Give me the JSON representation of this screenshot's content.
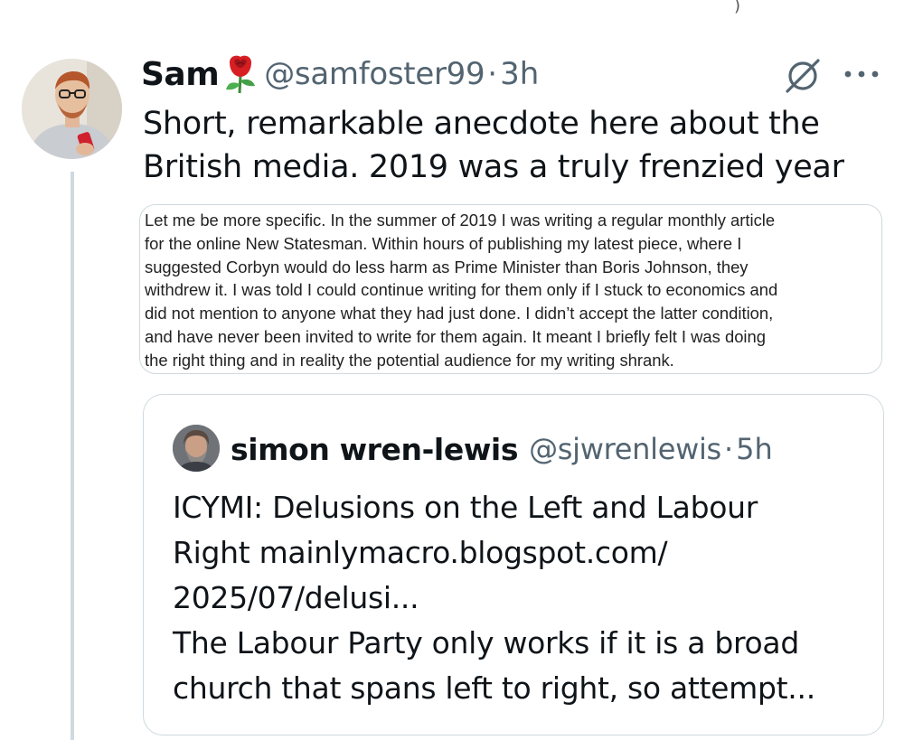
{
  "tweet": {
    "display_name": "Sam",
    "handle": "@samfoster99",
    "separator": "·",
    "time": "3h",
    "text_lines": [
      "Short, remarkable anecdote here about the",
      "British media. 2019 was a truly frenzied year"
    ],
    "image_text": "Let me be more specific. In the summer of 2019 I was writing a regular monthly article\nfor the online New Statesman. Within hours of publishing my latest piece, where I\nsuggested Corbyn would do less harm as Prime Minister than Boris Johnson, they\nwithdrew it. I was told I could continue writing for them only if I stuck to economics and\ndid not mention to anyone what they had just done. I didn’t accept the latter condition,\nand have never been invited to write for them again. It meant I briefly felt I was doing\nthe right thing and in reality the potential audience for my writing shrank."
  },
  "quote": {
    "display_name": "simon wren-lewis",
    "handle": "@sjwrenlewis",
    "separator": "·",
    "time": "5h",
    "text_lines": [
      "ICYMI: Delusions on the Left and Labour",
      "Right mainlymacro.blogspot.com/",
      "2025/07/delusi...",
      "The Labour Party only works if it is a broad",
      "church that spans left to right, so attempt..."
    ]
  },
  "icons": {
    "name_emoji": "rose-icon",
    "grok": "grok-icon",
    "more": "more-icon"
  },
  "colors": {
    "text": "#0f1419",
    "secondary": "#536471",
    "border": "#cfd9de",
    "rose": "#d61e23"
  }
}
